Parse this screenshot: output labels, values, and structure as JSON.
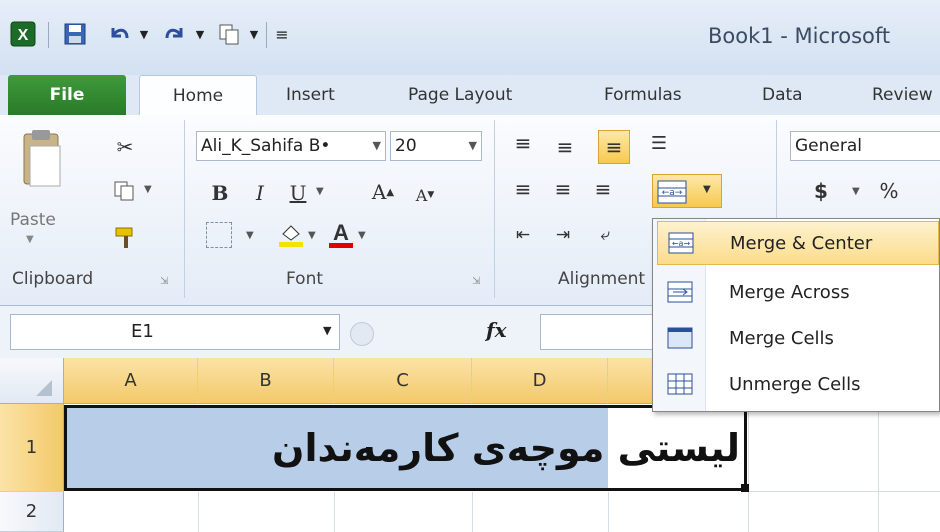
{
  "window": {
    "title": "Book1 - Microsoft"
  },
  "tabs": [
    "File",
    "Home",
    "Insert",
    "Page Layout",
    "Formulas",
    "Data",
    "Review"
  ],
  "clipboard": {
    "paste_label": "Paste",
    "group_label": "Clipboard"
  },
  "font": {
    "name": "Ali_K_Sahifa B•",
    "size": "20",
    "group_label": "Font",
    "bold": "B",
    "italic": "I",
    "underline": "U"
  },
  "alignment": {
    "group_label": "Alignment"
  },
  "number": {
    "format": "General",
    "currency": "$",
    "percent": "%"
  },
  "formula_bar": {
    "name_box": "E1",
    "fx": "fx",
    "formula": ""
  },
  "grid": {
    "columns": [
      "A",
      "B",
      "C",
      "D"
    ],
    "rows": [
      "1",
      "2"
    ],
    "cell_text": "لیستی موچەی کارمەندان"
  },
  "merge_menu": {
    "items": [
      "Merge & Center",
      "Merge Across",
      "Merge Cells",
      "Unmerge Cells"
    ],
    "highlighted": "Merge & Center"
  },
  "colors": {
    "file_tab": "#2a7a29",
    "selection": "#b8cde8",
    "highlight": "#fbdc8a",
    "fill_color": "#f1e400",
    "font_color": "#e00000"
  }
}
